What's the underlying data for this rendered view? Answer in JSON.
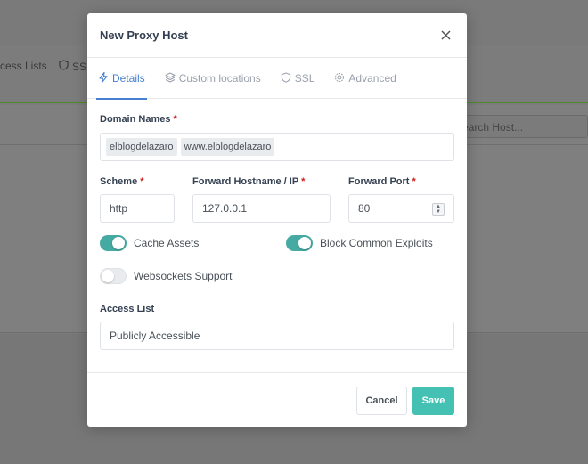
{
  "background": {
    "nav_items": [
      {
        "label": "cess Lists",
        "icon": "none"
      },
      {
        "label": "SSL",
        "icon": "shield-icon"
      }
    ],
    "search_placeholder": "earch Host..."
  },
  "modal": {
    "title": "New Proxy Host",
    "close_icon": "close-icon",
    "tabs": [
      {
        "label": "Details",
        "icon": "bolt-icon",
        "active": true
      },
      {
        "label": "Custom locations",
        "icon": "layers-icon",
        "active": false
      },
      {
        "label": "SSL",
        "icon": "shield-icon",
        "active": false
      },
      {
        "label": "Advanced",
        "icon": "gear-icon",
        "active": false
      }
    ],
    "domain_names": {
      "label": "Domain Names",
      "required_mark": "*",
      "tags": [
        "elblogdelazaro",
        "www.elblogdelazaro"
      ]
    },
    "scheme": {
      "label": "Scheme",
      "required_mark": "*",
      "value": "http"
    },
    "forward_hostname": {
      "label": "Forward Hostname / IP",
      "required_mark": "*",
      "value": "127.0.0.1"
    },
    "forward_port": {
      "label": "Forward Port",
      "required_mark": "*",
      "value": "80"
    },
    "toggles": {
      "cache_assets": {
        "label": "Cache Assets",
        "on": true
      },
      "block_exploits": {
        "label": "Block Common Exploits",
        "on": true
      },
      "websockets": {
        "label": "Websockets Support",
        "on": false
      }
    },
    "access_list": {
      "label": "Access List",
      "value": "Publicly Accessible"
    },
    "buttons": {
      "cancel": "Cancel",
      "save": "Save"
    }
  },
  "colors": {
    "accent_blue": "#467fcf",
    "teal": "#45c1b4",
    "toggle_on": "#45aaa1",
    "required": "#cd201f"
  }
}
